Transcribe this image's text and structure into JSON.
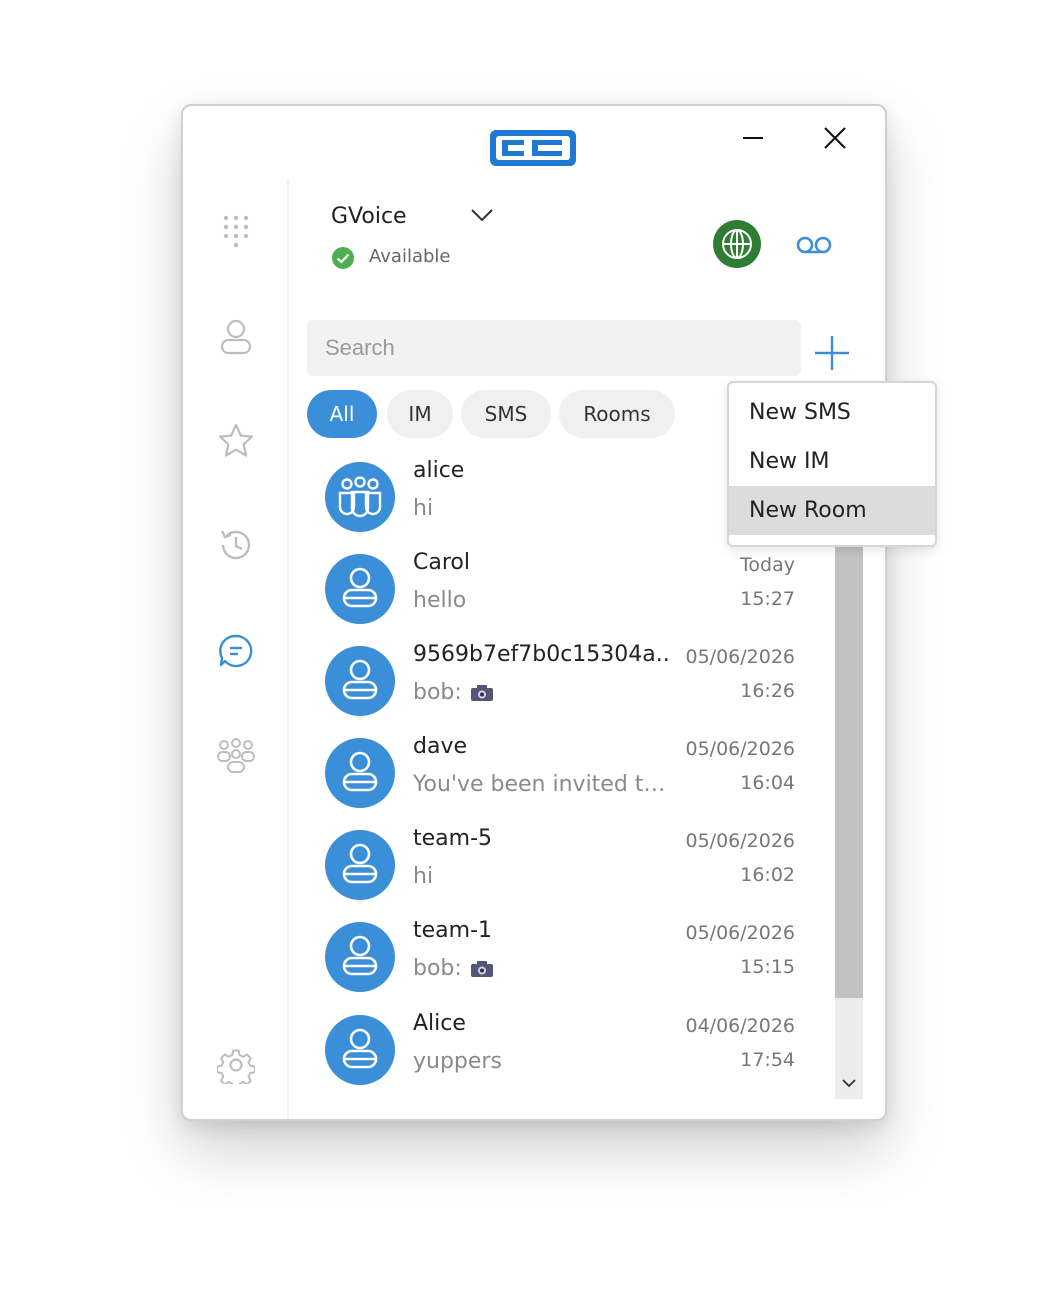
{
  "window": {
    "minimize_icon": "minimize-icon",
    "close_icon": "close-icon"
  },
  "header": {
    "account_name": "GVoice",
    "status": "Available",
    "colors": {
      "status_ok": "#4caf50",
      "globe": "#2e7d32",
      "accent": "#3b8fd8"
    }
  },
  "sidebar": {
    "items": [
      {
        "name": "dialpad-icon"
      },
      {
        "name": "contacts-icon"
      },
      {
        "name": "favorites-icon"
      },
      {
        "name": "history-icon"
      },
      {
        "name": "chat-icon",
        "active": true
      },
      {
        "name": "groups-icon"
      },
      {
        "name": "settings-icon"
      }
    ]
  },
  "search": {
    "placeholder": "Search",
    "value": ""
  },
  "filters": [
    {
      "label": "All",
      "active": true
    },
    {
      "label": "IM"
    },
    {
      "label": "SMS"
    },
    {
      "label": "Rooms"
    }
  ],
  "conversations": [
    {
      "name": "alice",
      "message": "hi",
      "date": "",
      "time": "",
      "avatar": "group"
    },
    {
      "name": "Carol",
      "message": "hello",
      "date": "Today",
      "time": "15:27",
      "avatar": "person"
    },
    {
      "name": "9569b7ef7b0c15304a...",
      "message": "bob:",
      "date": "05/06/2026",
      "time": "16:26",
      "avatar": "person",
      "camera": true
    },
    {
      "name": "dave",
      "message": "You've been invited to...",
      "date": "05/06/2026",
      "time": "16:04",
      "avatar": "person"
    },
    {
      "name": "team-5",
      "message": "hi",
      "date": "05/06/2026",
      "time": "16:02",
      "avatar": "person"
    },
    {
      "name": "team-1",
      "message": "bob:",
      "date": "05/06/2026",
      "time": "15:15",
      "avatar": "person",
      "camera": true
    },
    {
      "name": "Alice",
      "message": "yuppers",
      "date": "04/06/2026",
      "time": "17:54",
      "avatar": "person"
    }
  ],
  "new_menu": {
    "items": [
      {
        "label": "New SMS"
      },
      {
        "label": "New IM"
      },
      {
        "label": "New Room",
        "hovered": true
      }
    ]
  }
}
